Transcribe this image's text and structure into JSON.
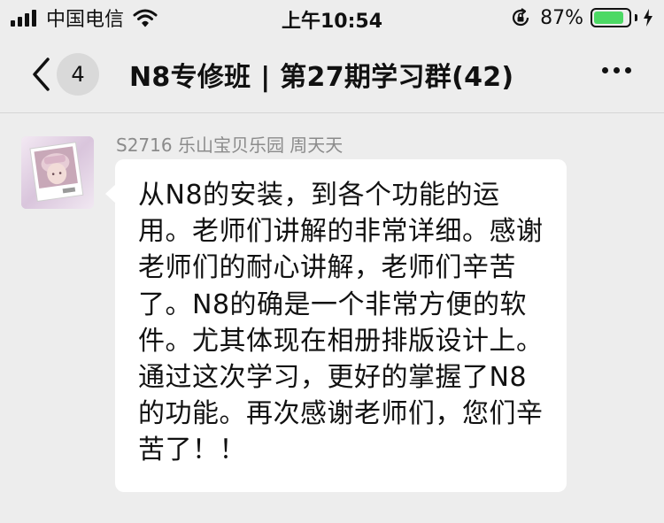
{
  "status_bar": {
    "carrier": "中国电信",
    "time": "上午10:54",
    "battery_percent": "87%",
    "battery_level": 0.87,
    "icons": [
      "signal-icon",
      "wifi-icon",
      "rotation-lock-icon",
      "battery-icon",
      "charging-bolt-icon"
    ]
  },
  "nav": {
    "back_icon": "chevron-left-icon",
    "unread_count": "4",
    "title": "N8专修班 | 第27期学习群(42)",
    "more_icon": "more-dots-icon"
  },
  "message": {
    "sender_name": "S2716 乐山宝贝乐园 周天天",
    "text": "从N8的安装，到各个功能的运用。老师们讲解的非常详细。感谢老师们的耐心讲解，老师们辛苦了。N8的确是一个非常方便的软件。尤其体现在相册排版设计上。通过这次学习，更好的掌握了N8的功能。再次感谢老师们，您们辛苦了！！"
  },
  "colors": {
    "background": "#ededed",
    "bubble": "#ffffff",
    "battery_green": "#4cd964",
    "sender_gray": "#8b8b8b"
  }
}
